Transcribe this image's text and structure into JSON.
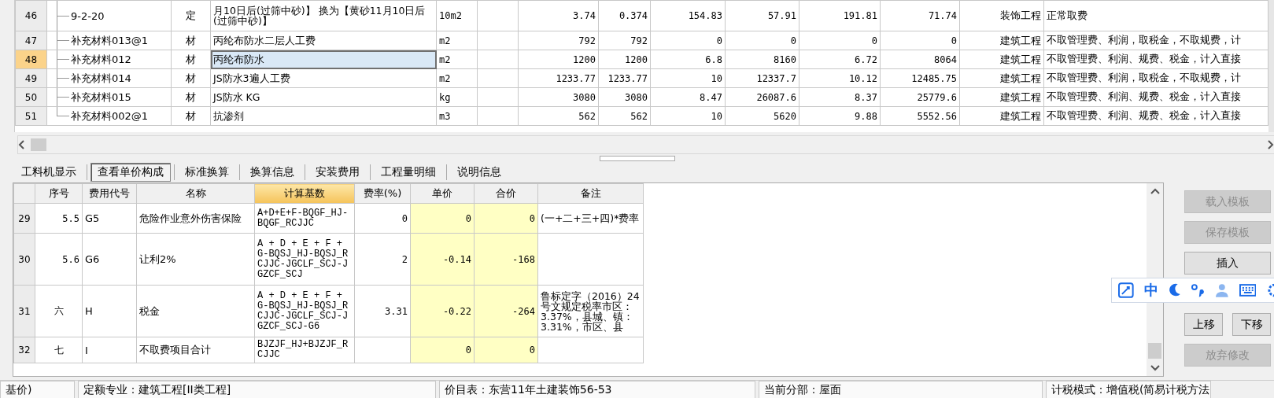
{
  "quota_table": {
    "rows": [
      {
        "number": "46",
        "code": "9-2-20",
        "type": "定",
        "name": "月10日后(过筛中砂)】  换为【黄砂11月10日后(过筛中砂)】",
        "unit": "10m2",
        "values": [
          "3.74",
          "0.374",
          "154.83",
          "57.91",
          "191.81",
          "71.74"
        ],
        "specialty": "装饰工程",
        "fee_rule": "正常取费",
        "selected": false
      },
      {
        "number": "47",
        "code": "补充材料013@1",
        "type": "材",
        "name": "丙纶布防水二层人工费",
        "unit": "m2",
        "values": [
          "792",
          "792",
          "0",
          "0",
          "0",
          "0"
        ],
        "specialty": "建筑工程",
        "fee_rule": "不取管理费、利润，取税金，不取规费，计",
        "selected": false
      },
      {
        "number": "48",
        "code": "补充材料012",
        "type": "材",
        "name": "丙纶布防水",
        "unit": "m2",
        "values": [
          "1200",
          "1200",
          "6.8",
          "8160",
          "6.72",
          "8064"
        ],
        "specialty": "建筑工程",
        "fee_rule": "不取管理费、利润、规费、税金，计入直接",
        "selected": true
      },
      {
        "number": "49",
        "code": "补充材料014",
        "type": "材",
        "name": "JS防水3遍人工费",
        "unit": "m2",
        "values": [
          "1233.77",
          "1233.77",
          "10",
          "12337.7",
          "10.12",
          "12485.75"
        ],
        "specialty": "建筑工程",
        "fee_rule": "不取管理费、利润，取税金，不取规费，计",
        "selected": false
      },
      {
        "number": "50",
        "code": "补充材料015",
        "type": "材",
        "name": "JS防水  KG",
        "unit": "kg",
        "values": [
          "3080",
          "3080",
          "8.47",
          "26087.6",
          "8.37",
          "25779.6"
        ],
        "specialty": "建筑工程",
        "fee_rule": "不取管理费、利润、规费、税金，计入直接",
        "selected": false
      },
      {
        "number": "51",
        "code": "补充材料002@1",
        "type": "材",
        "name": "抗渗剂",
        "unit": "m3",
        "values": [
          "562",
          "562",
          "10",
          "5620",
          "9.88",
          "5552.56"
        ],
        "specialty": "建筑工程",
        "fee_rule": "不取管理费、利润、规费、税金，计入直接",
        "selected": false
      }
    ]
  },
  "tabs": [
    {
      "label": "工料机显示",
      "selected": false
    },
    {
      "label": "查看单价构成",
      "selected": true
    },
    {
      "label": "标准换算",
      "selected": false
    },
    {
      "label": "换算信息",
      "selected": false
    },
    {
      "label": "安装费用",
      "selected": false
    },
    {
      "label": "工程量明细",
      "selected": false
    },
    {
      "label": "说明信息",
      "selected": false
    }
  ],
  "fee_table": {
    "columns": [
      {
        "label": "序号",
        "selected": false,
        "computed": false
      },
      {
        "label": "费用代号",
        "selected": false,
        "computed": false
      },
      {
        "label": "名称",
        "selected": false,
        "computed": false
      },
      {
        "label": "计算基数",
        "selected": true,
        "computed": false
      },
      {
        "label": "费率(%)",
        "selected": false,
        "computed": false
      },
      {
        "label": "单价",
        "selected": false,
        "computed": true
      },
      {
        "label": "合价",
        "selected": false,
        "computed": true
      },
      {
        "label": "备注",
        "selected": false,
        "computed": false
      }
    ],
    "rows": [
      {
        "number": "29",
        "cells": [
          "5.5",
          "G5",
          "危险作业意外伤害保险",
          "A+D+E+F-BQGF_HJ-BQGF_RCJJC",
          "0",
          "0",
          "0",
          "(一+二+三+四)*费率"
        ]
      },
      {
        "number": "30",
        "cells": [
          "5.6",
          "G6",
          "让利2%",
          "A + D + E + F + G-BQSJ_HJ-BQSJ_RCJJC-JGCLF_SCJ-JGZCF_SCJ",
          "2",
          "-0.14",
          "-168",
          null
        ]
      },
      {
        "number": "31",
        "cells": [
          "六",
          "H",
          "税金",
          "A + D + E + F + G-BQSJ_HJ-BQSJ_RCJJC-JGCLF_SCJ-JGZCF_SCJ-G6",
          "3.31",
          "-0.22",
          "-264",
          "鲁标定字（2016）24号文规定税率市区：3.37%，县城、镇：3.31%，市区、县"
        ]
      },
      {
        "number": "32",
        "cells": [
          "七",
          "I",
          "不取费项目合计",
          "BJZJF_HJ+BJZJF_RCJJC",
          null,
          "0",
          "0",
          null
        ]
      }
    ]
  },
  "side_buttons": [
    {
      "label": "载入模板",
      "disabled": true,
      "kind": "wide"
    },
    {
      "label": "保存模板",
      "disabled": true,
      "kind": "wide"
    },
    {
      "label": "插入",
      "disabled": false,
      "kind": "wide"
    },
    {
      "label": "上移",
      "disabled": false,
      "kind": "half"
    },
    {
      "label": "下移",
      "disabled": false,
      "kind": "half"
    },
    {
      "label": "放弃修改",
      "disabled": true,
      "kind": "wide"
    }
  ],
  "ime_toolbar": {
    "mode": "中"
  },
  "status_bar": [
    "基价)",
    "定额专业：建筑工程[II类工程]",
    "价目表：东营11年土建装饰56-53",
    "当前分部：屋面",
    "计税模式：增值税(简易计税方法"
  ]
}
